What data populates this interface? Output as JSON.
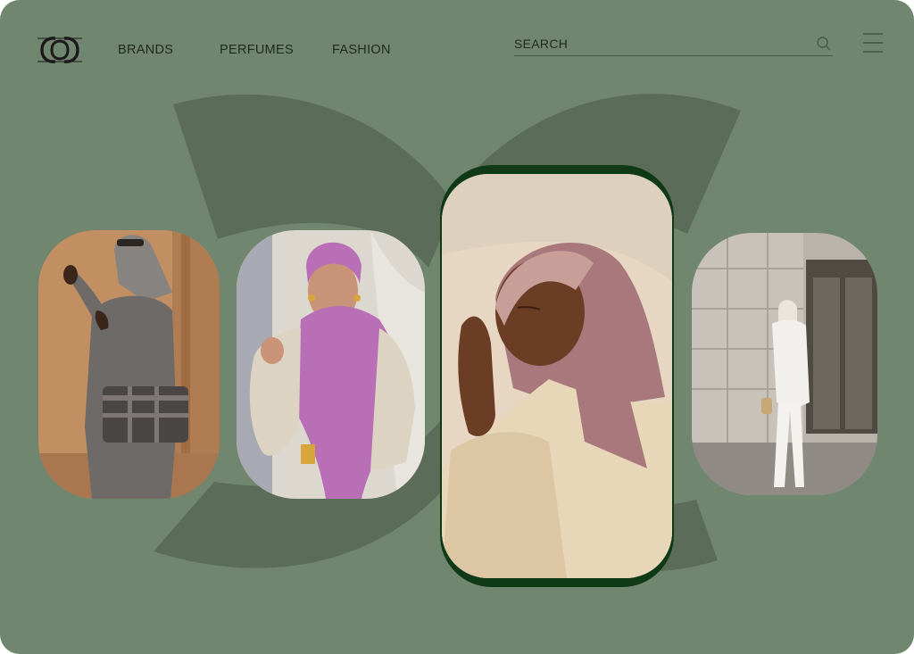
{
  "brand": {
    "logo_name": "double-c-logo",
    "accent": "#71866f",
    "accent_dark": "#5b6d59",
    "card_border": "#103a16"
  },
  "nav": {
    "items": [
      {
        "label": "BRANDS"
      },
      {
        "label": "PERFUMES"
      },
      {
        "label": "FASHION"
      }
    ]
  },
  "search": {
    "placeholder": "SEARCH",
    "icon": "search-icon"
  },
  "menu": {
    "icon": "hamburger-menu-icon"
  },
  "gallery": {
    "cards": [
      {
        "subject": "woman-grey-headscarf-handbag"
      },
      {
        "subject": "woman-purple-hijab"
      },
      {
        "subject": "woman-mauve-hijab-featured"
      },
      {
        "subject": "woman-white-suit-street"
      }
    ]
  }
}
